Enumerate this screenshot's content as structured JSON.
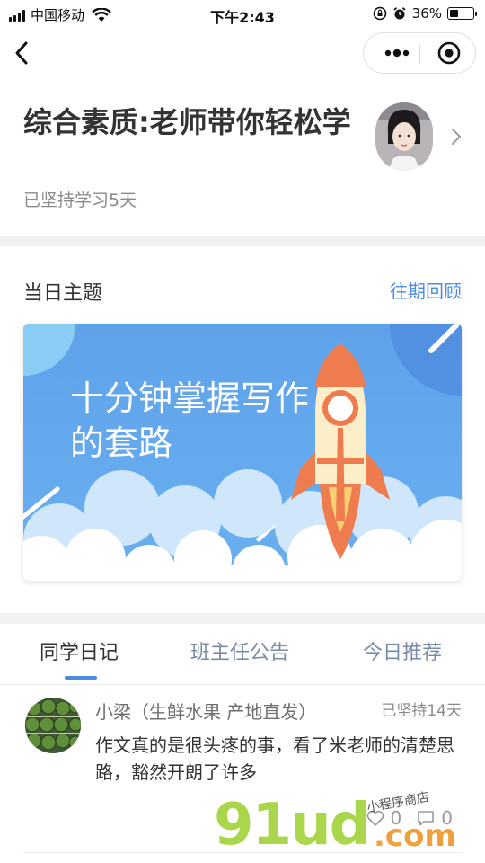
{
  "status_bar": {
    "carrier": "中国移动",
    "time": "下午2:43",
    "battery_percent": "36%",
    "battery_level": 0.36
  },
  "header": {
    "title": "综合素质:老师带你轻松学",
    "streak": "已坚持学习5天"
  },
  "daily_theme": {
    "label": "当日主题",
    "history_link": "往期回顾",
    "banner_title": "十分钟掌握写作的套路"
  },
  "tabs": [
    {
      "label": "同学日记",
      "active": true
    },
    {
      "label": "班主任公告",
      "active": false
    },
    {
      "label": "今日推荐",
      "active": false
    }
  ],
  "diary": {
    "name": "小梁（生鲜水果 产地直发）",
    "streak": "已坚持14天",
    "text": "作文真的是很头疼的事，看了米老师的清楚思路，豁然开朗了许多",
    "likes": "0",
    "comments": "0"
  },
  "watermark": {
    "logo": "91ud",
    "suffix": ".com",
    "handwriting": "小程序商店"
  },
  "colors": {
    "accent": "#4a8be4",
    "banner_sky": "#5fa3ec",
    "rocket_orange": "#ef7c4e"
  },
  "icons": [
    "signal-icon",
    "wifi-icon",
    "lock-rotation-icon",
    "alarm-icon",
    "battery-icon",
    "back-arrow-icon",
    "more-dots-icon",
    "close-target-icon",
    "chevron-right-icon",
    "heart-icon",
    "comment-icon"
  ]
}
